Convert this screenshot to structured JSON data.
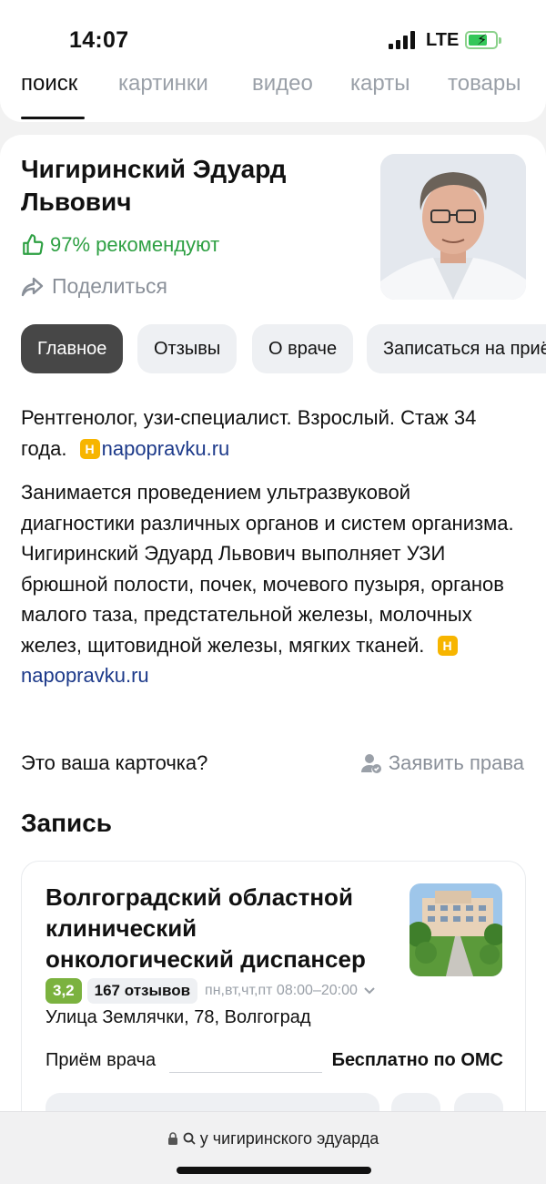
{
  "status_bar": {
    "time": "14:07",
    "network": "LTE"
  },
  "search_tabs": [
    {
      "label": "поиск",
      "active": true
    },
    {
      "label": "картинки",
      "active": false
    },
    {
      "label": "видео",
      "active": false
    },
    {
      "label": "карты",
      "active": false
    },
    {
      "label": "товары",
      "active": false
    }
  ],
  "doctor": {
    "name": "Чигиринский Эдуард Львович",
    "recommend": "97% рекомендуют",
    "share": "Поделиться"
  },
  "chips": [
    {
      "label": "Главное",
      "active": true
    },
    {
      "label": "Отзывы",
      "active": false
    },
    {
      "label": "О враче",
      "active": false
    },
    {
      "label": "Записаться на приём",
      "active": false
    }
  ],
  "about": {
    "summary": "Рентгенолог, узи-специалист. Взрослый. Стаж 34 года.",
    "summary_source": "napopravku.ru",
    "description": "Занимается проведением ультразвуковой диагностики различных органов и систем организма. Чигиринский Эдуард Львович выполняет УЗИ брюшной полости, почек, мочевого пузыря, органов малого таза, предстательной железы, молочных желез, щитовидной железы, мягких тканей.",
    "description_source": "napopravku.ru",
    "source_badge": "Н"
  },
  "claim": {
    "question": "Это ваша карточка?",
    "action": "Заявить права"
  },
  "appointment": {
    "title": "Запись",
    "clinic_name": "Волгоградский областной клинический онкологический диспансер",
    "rating": "3,2",
    "reviews": "167 отзывов",
    "hours": "пн,вт,чт,пт 08:00–20:00",
    "address": "Улица Землячки, 78, Волгоград",
    "visit_label": "Приём врача",
    "visit_price": "Бесплатно по ОМС"
  },
  "address_bar": {
    "query": "у чигиринского эдуарда"
  },
  "colors": {
    "accent_green": "#2ea043",
    "source_link": "#1d3a8a",
    "rating_green": "#7bb23f",
    "chip_active": "#474747"
  }
}
